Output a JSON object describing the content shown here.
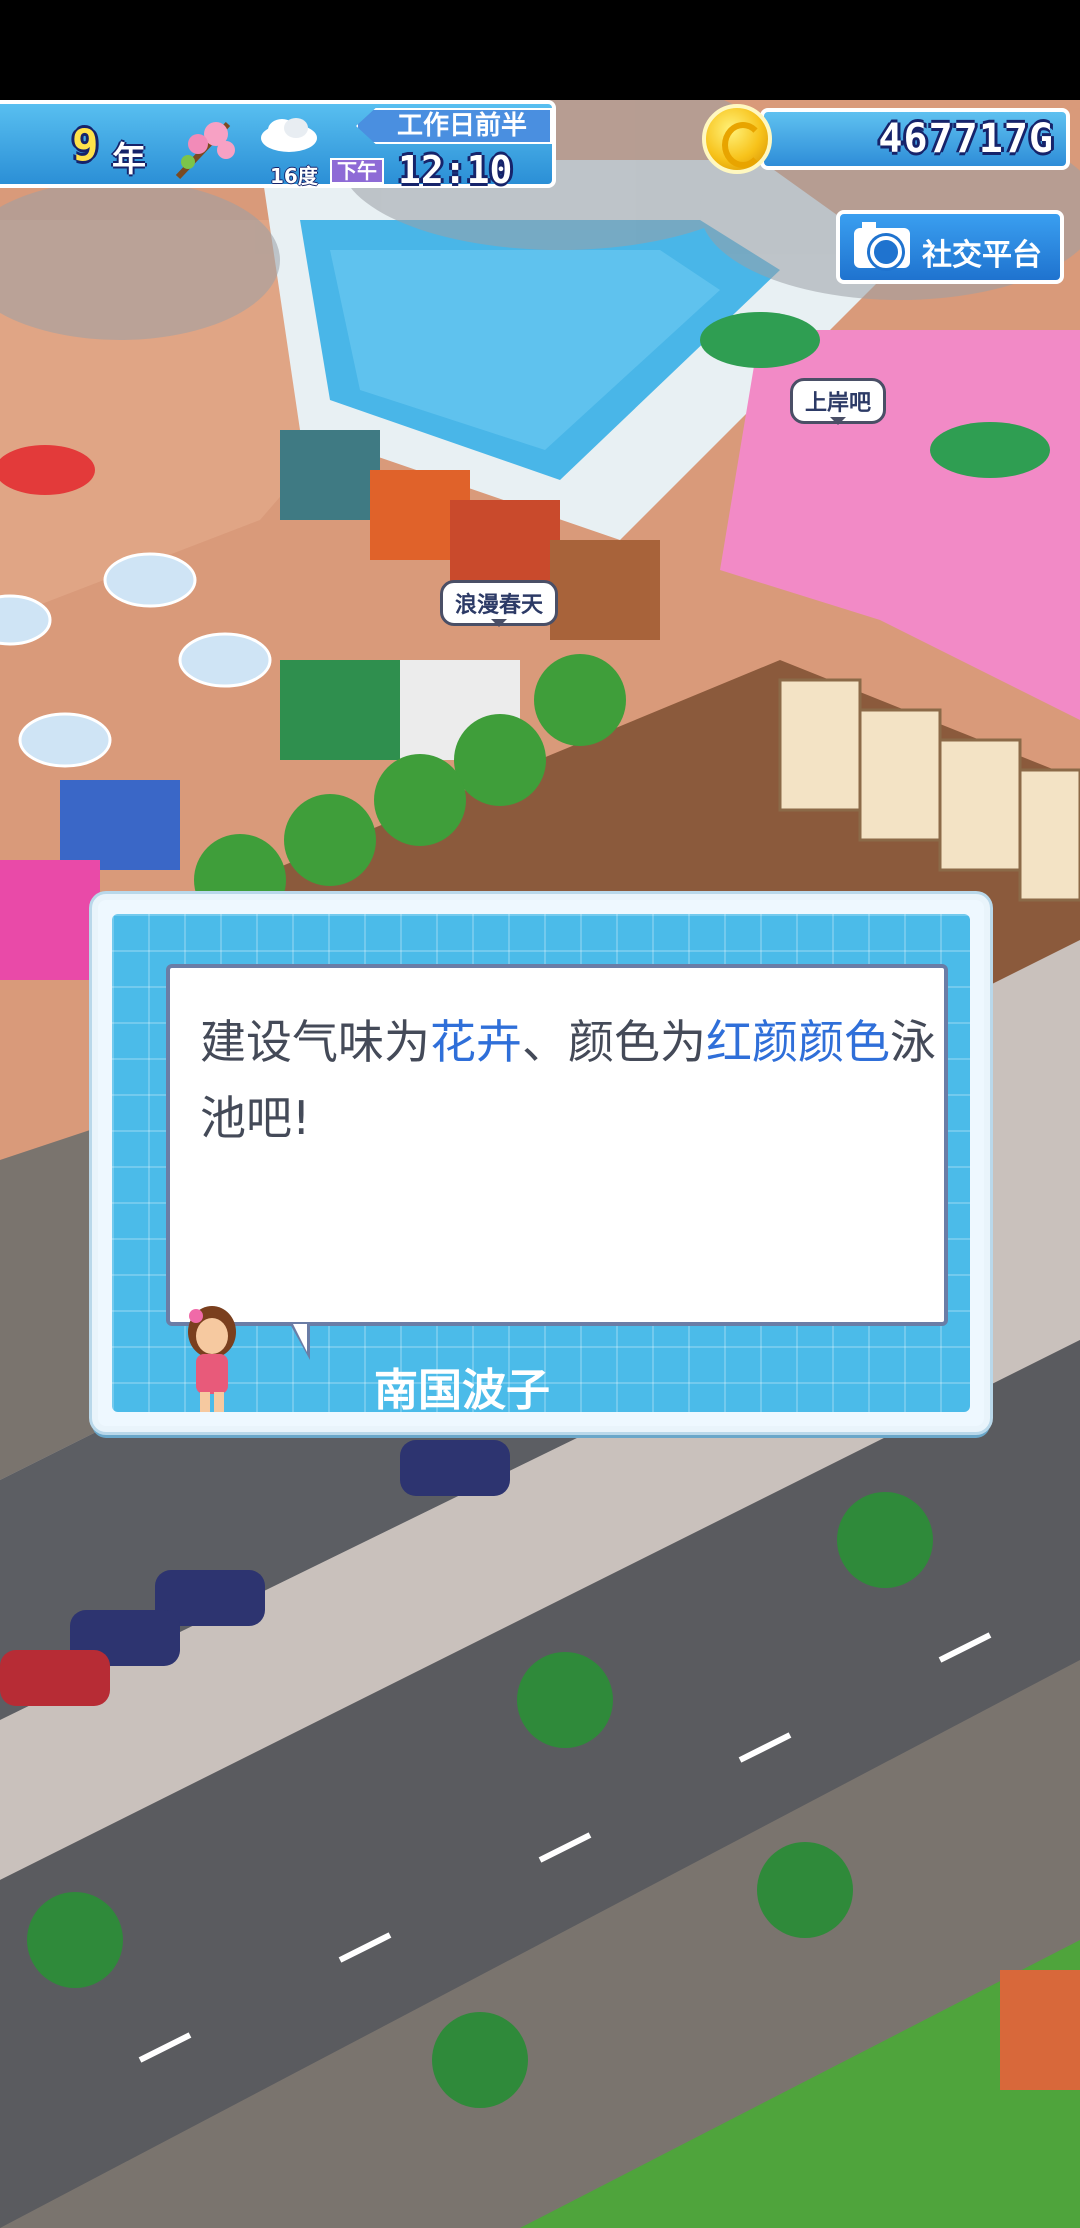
{
  "hud": {
    "year_number": "9",
    "year_unit": "年",
    "period": "工作日前半",
    "temperature": "16度",
    "am_pm": "下午",
    "time": "12:10",
    "money": "467717G",
    "flower_icon": "cherry-blossom-branch",
    "weather_icon": "cloudy"
  },
  "social_button": {
    "label": "社交平台",
    "icon": "camera"
  },
  "scene_bubbles": {
    "shore": "上岸吧",
    "romance": "浪漫春天"
  },
  "dialog": {
    "message_parts": [
      {
        "text": "建设气味为",
        "highlight": false
      },
      {
        "text": "花卉",
        "highlight": true
      },
      {
        "text": "、颜色为",
        "highlight": false
      },
      {
        "text": "红颜颜色",
        "highlight": true
      },
      {
        "text": "泳池吧!",
        "highlight": false
      }
    ],
    "speaker": "南国波子"
  },
  "colors": {
    "hud_blue": "#2b8fd6",
    "highlight_text": "#2f6fd9",
    "dialog_frame": "#4bbbe9",
    "money_gold": "#f7c21a"
  }
}
